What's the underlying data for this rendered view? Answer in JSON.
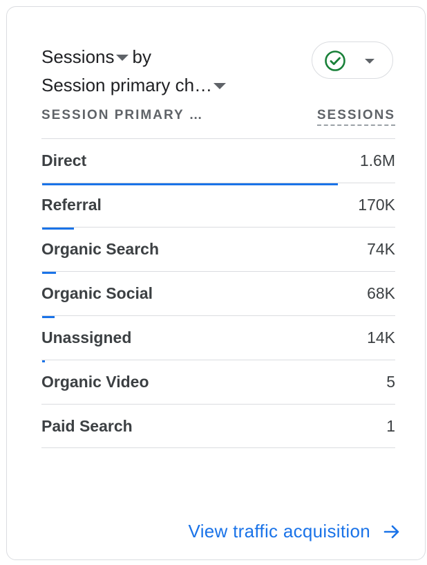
{
  "header": {
    "metric_label": "Sessions",
    "by_label": "by",
    "dimension_label": "Session primary ch…"
  },
  "status_chip": {
    "icon": "check-circle-icon",
    "dropdown_icon": "caret-down-icon",
    "color": "#188038"
  },
  "columns": {
    "dimension": "SESSION PRIMARY …",
    "metric": "SESSIONS"
  },
  "rows": [
    {
      "label": "Direct",
      "value": "1.6M",
      "share": 0.835
    },
    {
      "label": "Referral",
      "value": "170K",
      "share": 0.09
    },
    {
      "label": "Organic Search",
      "value": "74K",
      "share": 0.04
    },
    {
      "label": "Organic Social",
      "value": "68K",
      "share": 0.036
    },
    {
      "label": "Unassigned",
      "value": "14K",
      "share": 0.008
    },
    {
      "label": "Organic Video",
      "value": "5",
      "share": 0
    },
    {
      "label": "Paid Search",
      "value": "1",
      "share": 0
    }
  ],
  "footer": {
    "link_label": "View traffic acquisition",
    "icon": "arrow-right-icon"
  },
  "colors": {
    "accent": "#1a73e8",
    "success": "#188038"
  }
}
